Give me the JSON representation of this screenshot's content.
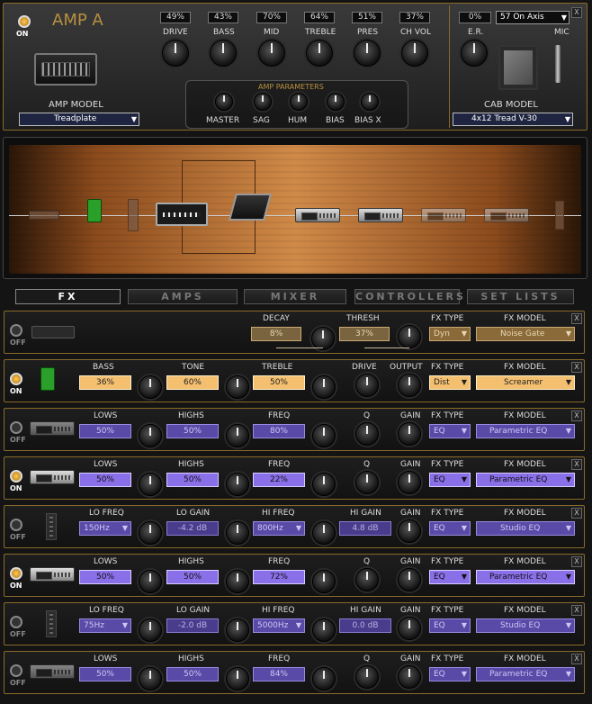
{
  "amp": {
    "title": "AMP A",
    "power": "ON",
    "model_label": "AMP MODEL",
    "model_value": "Treadplate",
    "params": [
      {
        "label": "DRIVE",
        "value": "49%"
      },
      {
        "label": "BASS",
        "value": "43%"
      },
      {
        "label": "MID",
        "value": "70%"
      },
      {
        "label": "TREBLE",
        "value": "64%"
      },
      {
        "label": "PRES",
        "value": "51%"
      },
      {
        "label": "CH VOL",
        "value": "37%"
      }
    ],
    "group_label": "AMP PARAMETERS",
    "group_knobs": [
      "MASTER",
      "SAG",
      "HUM",
      "BIAS",
      "BIAS X"
    ],
    "er_label": "E.R.",
    "er_value": "0%",
    "mic_label": "MIC",
    "mic_value": "57 On Axis",
    "cab_label": "CAB MODEL",
    "cab_value": "4x12 Tread V-30",
    "close": "X"
  },
  "tabs": [
    "FX",
    "AMPS",
    "MIXER",
    "CONTROLLERS",
    "SET LISTS"
  ],
  "fx_rows": [
    {
      "power": "OFF",
      "controls": [
        {
          "label": "DECAY",
          "value": "8%"
        },
        {
          "label": "THRESH",
          "value": "37%"
        }
      ],
      "type_label": "FX TYPE",
      "type": "Dyn",
      "model_label": "FX MODEL",
      "model": "Noise Gate",
      "close": "X"
    },
    {
      "power": "ON",
      "controls": [
        {
          "label": "BASS",
          "value": "36%"
        },
        {
          "label": "TONE",
          "value": "60%"
        },
        {
          "label": "TREBLE",
          "value": "50%"
        }
      ],
      "knob_labels": [
        "DRIVE",
        "OUTPUT"
      ],
      "type_label": "FX TYPE",
      "type": "Dist",
      "model_label": "FX MODEL",
      "model": "Screamer",
      "close": "X"
    },
    {
      "power": "OFF",
      "controls": [
        {
          "label": "LOWS",
          "value": "50%"
        },
        {
          "label": "HIGHS",
          "value": "50%"
        },
        {
          "label": "FREQ",
          "value": "80%"
        }
      ],
      "knob_labels": [
        "Q",
        "GAIN"
      ],
      "type_label": "FX TYPE",
      "type": "EQ",
      "model_label": "FX MODEL",
      "model": "Parametric EQ",
      "close": "X"
    },
    {
      "power": "ON",
      "controls": [
        {
          "label": "LOWS",
          "value": "50%"
        },
        {
          "label": "HIGHS",
          "value": "50%"
        },
        {
          "label": "FREQ",
          "value": "22%"
        }
      ],
      "knob_labels": [
        "Q",
        "GAIN"
      ],
      "type_label": "FX TYPE",
      "type": "EQ",
      "model_label": "FX MODEL",
      "model": "Parametric EQ",
      "close": "X"
    },
    {
      "power": "OFF",
      "controls": [
        {
          "label": "LO FREQ",
          "value": "150Hz"
        },
        {
          "label": "LO GAIN",
          "value": "-4.2 dB"
        },
        {
          "label": "HI FREQ",
          "value": "800Hz"
        },
        {
          "label": "HI GAIN",
          "value": "4.8 dB"
        }
      ],
      "knob_labels": [
        "GAIN"
      ],
      "type_label": "FX TYPE",
      "type": "EQ",
      "model_label": "FX MODEL",
      "model": "Studio EQ",
      "close": "X"
    },
    {
      "power": "ON",
      "controls": [
        {
          "label": "LOWS",
          "value": "50%"
        },
        {
          "label": "HIGHS",
          "value": "50%"
        },
        {
          "label": "FREQ",
          "value": "72%"
        }
      ],
      "knob_labels": [
        "Q",
        "GAIN"
      ],
      "type_label": "FX TYPE",
      "type": "EQ",
      "model_label": "FX MODEL",
      "model": "Parametric EQ",
      "close": "X"
    },
    {
      "power": "OFF",
      "controls": [
        {
          "label": "LO FREQ",
          "value": "75Hz"
        },
        {
          "label": "LO GAIN",
          "value": "-2.0 dB"
        },
        {
          "label": "HI FREQ",
          "value": "5000Hz"
        },
        {
          "label": "HI GAIN",
          "value": "0.0 dB"
        }
      ],
      "knob_labels": [
        "GAIN"
      ],
      "type_label": "FX TYPE",
      "type": "EQ",
      "model_label": "FX MODEL",
      "model": "Studio EQ",
      "close": "X"
    },
    {
      "power": "OFF",
      "controls": [
        {
          "label": "LOWS",
          "value": "50%"
        },
        {
          "label": "HIGHS",
          "value": "50%"
        },
        {
          "label": "FREQ",
          "value": "84%"
        }
      ],
      "knob_labels": [
        "Q",
        "GAIN"
      ],
      "type_label": "FX TYPE",
      "type": "EQ",
      "model_label": "FX MODEL",
      "model": "Parametric EQ",
      "close": "X"
    }
  ]
}
